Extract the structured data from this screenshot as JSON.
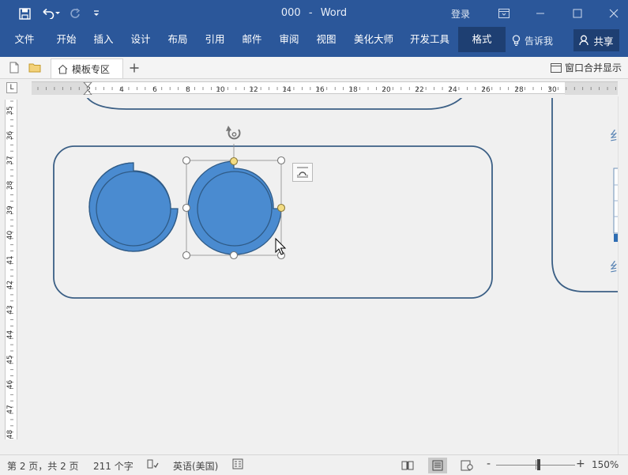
{
  "window": {
    "doc_name": "000",
    "separator": "-",
    "app_name": "Word",
    "login": "登录"
  },
  "ribbon": {
    "tabs": [
      {
        "label": "文件"
      },
      {
        "label": "开始"
      },
      {
        "label": "插入"
      },
      {
        "label": "设计"
      },
      {
        "label": "布局"
      },
      {
        "label": "引用"
      },
      {
        "label": "邮件"
      },
      {
        "label": "审阅"
      },
      {
        "label": "视图"
      },
      {
        "label": "美化大师"
      },
      {
        "label": "开发工具"
      },
      {
        "label": "格式",
        "active": true
      }
    ],
    "tell_me": "告诉我",
    "share": "共享"
  },
  "tabbar": {
    "doc_tab": "模板专区",
    "merge_windows": "窗口合并显示"
  },
  "ruler": {
    "h_labels": [
      "2",
      "2",
      "4",
      "6",
      "8",
      "10",
      "12",
      "14",
      "16",
      "18",
      "20",
      "22",
      "24",
      "26",
      "28",
      "30"
    ],
    "v_labels": [
      "35",
      "36",
      "37",
      "38",
      "39",
      "40",
      "41",
      "42",
      "43",
      "44",
      "45",
      "46",
      "47",
      "48"
    ],
    "tab_selector": "L"
  },
  "page_content": {
    "edge_glyph_top": "纟",
    "edge_glyph_bottom": "纟"
  },
  "colors": {
    "title_blue": "#2b579a",
    "shape_fill": "#4a8bd0",
    "shape_stroke": "#2f5b87",
    "frame_stroke": "#3b5f85",
    "handle_yellow": "#f3dc83"
  },
  "statusbar": {
    "page_info": "第 2 页，共 2 页",
    "word_count": "211 个字",
    "language": "英语(美国)",
    "zoom_minus": "-",
    "zoom_plus": "+",
    "zoom_level": "150%"
  }
}
